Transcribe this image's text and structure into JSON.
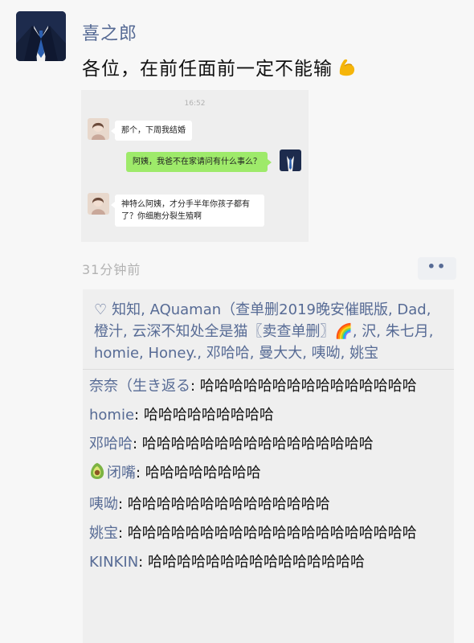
{
  "post": {
    "username": "喜之郎",
    "text": "各位，在前任面前一定不能输",
    "time": "31分钟前",
    "more_label": "••"
  },
  "screenshot": {
    "time": "16:52",
    "messages": [
      {
        "side": "left",
        "text": "那个，下周我结婚"
      },
      {
        "side": "right",
        "text": "阿姨，我爸不在家请问有什么事么？"
      },
      {
        "side": "left",
        "text": "神特么阿姨，才分手半年你孩子都有了？你细胞分裂生殖啊"
      }
    ]
  },
  "likes": {
    "text": "知知, AQuaman（查单删2019晚安催眠版, Dad, 橙汁, 云深不知处全是猫〖卖查单删〗🌈, 沢, 朱七月, homie, Honey., 邓哈哈, 曼大大, 咦呦, 姚宝"
  },
  "comments": [
    {
      "name": "奈奈（生き返る",
      "text": "哈哈哈哈哈哈哈哈哈哈哈哈哈哈哈"
    },
    {
      "name": "homie",
      "text": "哈哈哈哈哈哈哈哈哈"
    },
    {
      "name": "邓哈哈",
      "text": "哈哈哈哈哈哈哈哈哈哈哈哈哈哈哈哈"
    },
    {
      "name": "闭嘴",
      "text": "哈哈哈哈哈哈哈哈"
    },
    {
      "name": "咦呦",
      "text": "哈哈哈哈哈哈哈哈哈哈哈哈哈哈"
    },
    {
      "name": "姚宝",
      "text": "哈哈哈哈哈哈哈哈哈哈哈哈哈哈哈哈哈哈哈哈"
    },
    {
      "name": "KINKIN",
      "text": "哈哈哈哈哈哈哈哈哈哈哈哈哈哈哈"
    }
  ]
}
